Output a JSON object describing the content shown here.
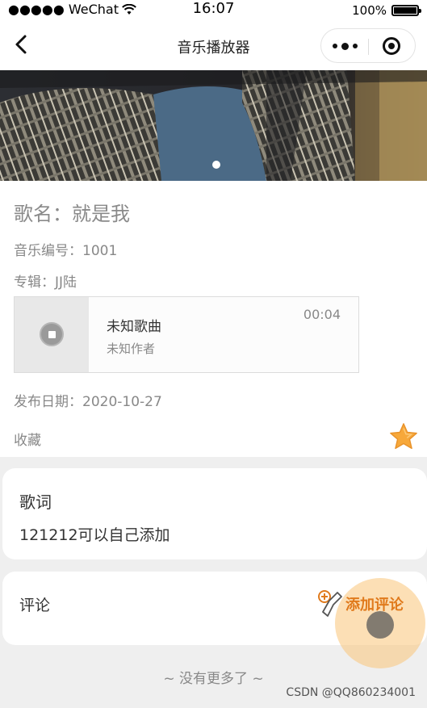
{
  "status_bar": {
    "carrier": "●●●●● WeChat",
    "time": "16:07",
    "battery_text": "100%"
  },
  "nav": {
    "title": "音乐播放器",
    "back_icon": "chevron-left-icon",
    "more_icon": "more-dots-icon",
    "close_icon": "record-target-icon"
  },
  "banner": {
    "indicator_count": 1
  },
  "song": {
    "title": "歌名：就是我",
    "number": "音乐编号：1001",
    "album": "专辑：JJ陆",
    "release_date": "发布日期：2020-10-27",
    "favorite_label": "收藏",
    "favorite_icon": "star-icon",
    "favorite_color": "#f7a83a"
  },
  "player": {
    "name": "未知歌曲",
    "author": "未知作者",
    "duration": "00:04"
  },
  "lyrics": {
    "title": "歌词",
    "text": "121212可以自己添加"
  },
  "comments": {
    "title": "评论",
    "add_label": "添加评论",
    "add_color": "#e07a1c"
  },
  "footer": {
    "no_more": "~ 没有更多了 ~",
    "watermark": "CSDN @QQ860234001"
  }
}
